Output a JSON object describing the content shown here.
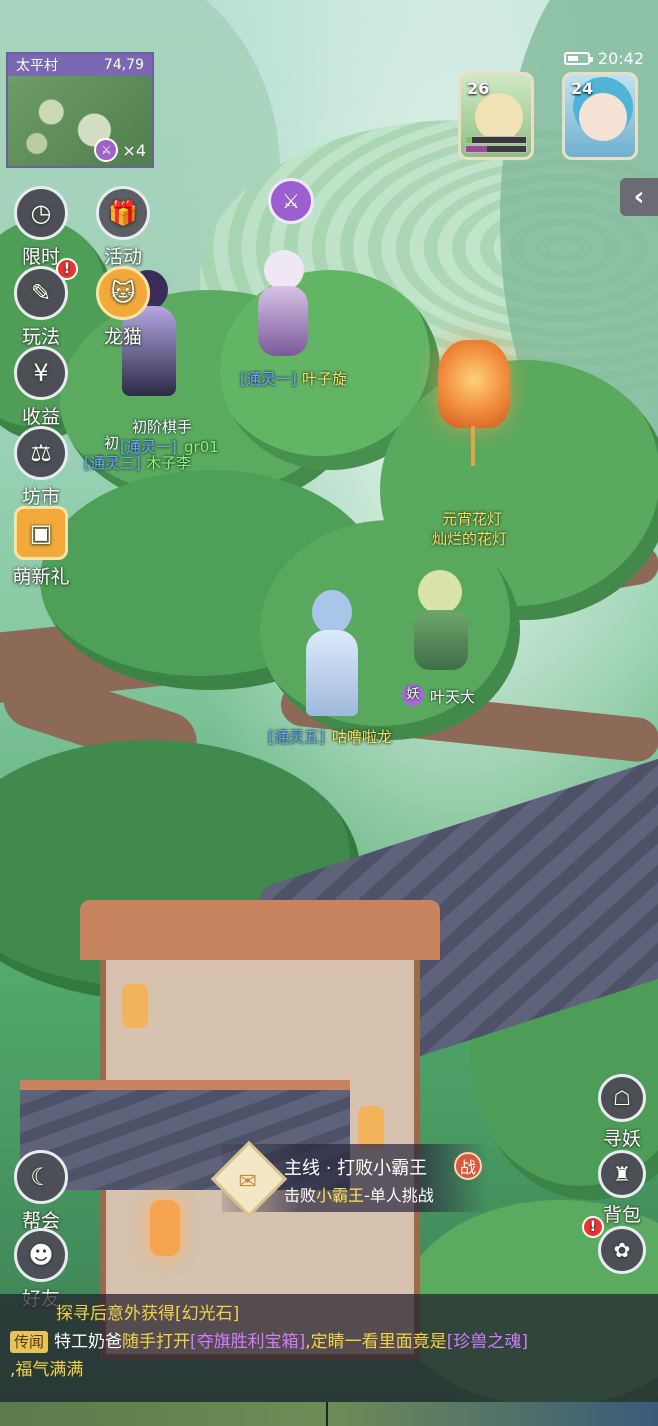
{
  "status": {
    "time": "20:42"
  },
  "minimap": {
    "location": "太平村",
    "coords": "74,79",
    "count": "×4"
  },
  "portraits": [
    {
      "level": "26",
      "hp": 0.1,
      "mp": 0.35
    },
    {
      "level": "24"
    }
  ],
  "left_menu": [
    {
      "label": "限时",
      "icon": "clock-icon"
    },
    {
      "label": "活动",
      "icon": "gift-box-icon"
    },
    {
      "label": "玩法",
      "icon": "scroll-icon",
      "alert": "!"
    },
    {
      "label": "龙猫",
      "icon": "cat-face-icon"
    },
    {
      "label": "收益",
      "icon": "money-bag-icon"
    },
    {
      "label": "坊市",
      "icon": "scale-icon"
    },
    {
      "label": "萌新礼",
      "icon": "treasure-chest-icon"
    },
    {
      "label": "帮会",
      "icon": "guild-icon"
    },
    {
      "label": "好友",
      "icon": "friends-icon"
    }
  ],
  "characters": {
    "player1": {
      "title": "初阶棋手",
      "tag": "[通灵三]",
      "name": "木子李",
      "overlay_tag": "[通灵一]",
      "overlay_name": "gr01",
      "overlay_prefix": "初"
    },
    "player2": {
      "tag": "[通灵一]",
      "name": "叶子旋"
    },
    "player3": {
      "tag": "[通灵五]",
      "name": "咕噜啦龙"
    },
    "pet": {
      "badge": "妖",
      "name": "叶天大"
    },
    "lantern": {
      "title": "元宵花灯",
      "name": "灿烂的花灯"
    }
  },
  "quest": {
    "title": "主线 · 打败小霸王",
    "sub_prefix": "击败",
    "sub_target": "小霸王",
    "sub_suffix": "-单人挑战",
    "badge": "战"
  },
  "right_menu": [
    {
      "label": "寻妖",
      "icon": "fox-search-icon"
    },
    {
      "label": "背包",
      "icon": "bag-icon"
    },
    {
      "label": "",
      "icon": "flower-menu-icon",
      "alert": "!"
    }
  ],
  "chat": {
    "line1": "探寻后意外获得[幻光石]",
    "tag": "传闻",
    "line2_a": "特工奶爸",
    "line2_b": "随手打开",
    "line2_c": "[夺旗胜利宝箱]",
    "line2_d": ",定睛一看里面竟是",
    "line2_e": "[珍兽之魂]",
    "line3": ",福气满满"
  },
  "colors": {
    "accent_purple": "#9b5fd0",
    "quest_highlight": "#ffe45a",
    "chat_gold": "#f3d24a"
  }
}
